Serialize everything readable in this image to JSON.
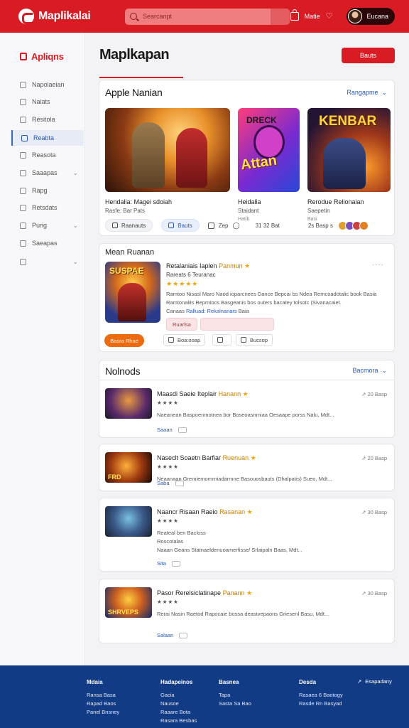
{
  "header": {
    "brand": "Maplikalai",
    "search_placeholder": "Searcanpt",
    "cart_label": "Matie",
    "user_name": "Eucana",
    "bg_color": "#d91c24"
  },
  "sidebar": {
    "title": "Apliqns",
    "items": [
      {
        "label": "Napolaeian",
        "icon": "doc-icon"
      },
      {
        "label": "Naiats",
        "icon": "user-icon"
      },
      {
        "label": "Resitola",
        "icon": "folder-icon"
      },
      {
        "label": "Reabta",
        "icon": "grid-icon",
        "active": true
      },
      {
        "label": "Reasota",
        "icon": "star-icon"
      },
      {
        "label": "Saaapas",
        "icon": "settings-icon",
        "chevron": true
      },
      {
        "label": "Rapg",
        "icon": "page-icon"
      },
      {
        "label": "Retsdats",
        "icon": "clock-icon"
      },
      {
        "label": "Purig",
        "icon": "tag-icon",
        "chevron": true
      },
      {
        "label": "Saeapas",
        "icon": "flag-icon"
      },
      {
        "label": "",
        "icon": "list-icon",
        "chevron": true
      }
    ]
  },
  "main": {
    "title": "Maplkapan",
    "top_button": "Bauts"
  },
  "apps": {
    "title": "Apple Nanian",
    "link": "Rangapme",
    "tiles": [
      {
        "name": "Hendalia: Magei sdoiah",
        "sub": "Rasfe: Bar Pats"
      },
      {
        "name": "Heidalia",
        "sub": "Staidant",
        "extra": "Hatib",
        "art_title": "DRECK",
        "art_word": "Attan"
      },
      {
        "name": "Rerodue Relionaian",
        "sub": "Saepetin",
        "extra": "Basi",
        "art_word": "KENBAR"
      }
    ],
    "bar": {
      "chip1": "Raanauts",
      "chip2": "Bauts",
      "tag": "Zep",
      "meta": "31 32 Bat",
      "meta2": "2s Basp s"
    }
  },
  "featured": {
    "section": "Mean Ruanan",
    "title": "Retalaniais Iaplen",
    "title_accent": "Panmun",
    "sub": "Rareats 6 Teuranac",
    "desc1": "Ramtoo Nisasl Maro Naod ioparcnees Dance Bepcai bs Ndea Remcoadotalic book Basia",
    "desc2": "Ramtonalits Bepmtocs Basgeanis bos outers bacatey tolsotc (Sivanacaiet.",
    "desc3_a": "Canaas",
    "desc3_link": "Ralluad: Rekalnanars",
    "desc3_b": "Baia",
    "input_label": "Ruarlsa",
    "primary_button": "Basra Rhae",
    "tool1": "Boa:ooap",
    "tool2": "",
    "tool3": "Bucsop",
    "art_word": "SUSPAE"
  },
  "methods": {
    "title": "Nolnods",
    "link": "Bacmora",
    "items": [
      {
        "title": "Maasdi Saeie Iteplair",
        "accent": "Hanann",
        "meta": "20 Basp",
        "line1": "Naeanean Baspoenmotnea bor Boseoasnmiaa Oesaape porss Nalu, Mdt...",
        "line2": "",
        "link": "Saaan"
      },
      {
        "title": "Naseclt Soaetn Barfiar",
        "accent": "Ruenuan",
        "meta": "20 Basp",
        "line1": "Neaanaan Gremiemomrniadarmne Basouosbauts (Dhalpatis) Sueo, Mdt...",
        "line2": "",
        "link": "Saba",
        "art_word": "FRD"
      },
      {
        "title": "Naancr Risaan Raeio",
        "accent": "Rasanan",
        "meta": "30 Basp",
        "line1": "Reateal ben Bacloss",
        "line2": "Roscotalas",
        "line3": "Naaan Geans Statnaeldenuoamerfisse/ Srlaipaln Baas, Mdt...",
        "link": "Sita"
      },
      {
        "title": "Pasor Rerelsiclatinape",
        "accent": "Panann",
        "meta": "30 Basp",
        "line1": "Rerai Nasin Raetod Rapocaie bossa deastvepaons Griesenl Basu, Mdt...",
        "line2": "",
        "link": "Salaan",
        "art_word": "SHRVEPS"
      }
    ]
  },
  "footer": {
    "columns": [
      {
        "heading": "Mdaia",
        "items": [
          "Ransa Basa",
          "Rapad Baos",
          "Panel Bnsney"
        ]
      },
      {
        "heading": "Hadapeinos",
        "items": [
          "Gacia",
          "Nausoe",
          "Raaare Bota",
          "Rasara Besbas"
        ]
      },
      {
        "heading": "Basnea",
        "items": [
          "Tapa",
          "Sasta Sa Bao"
        ]
      },
      {
        "heading": "Desda",
        "items": [
          "Rasaea 6 Baotogy",
          "Rasde Rn Basyad"
        ]
      }
    ],
    "corner_link": "Esapadany",
    "bg_color": "#123b86"
  }
}
